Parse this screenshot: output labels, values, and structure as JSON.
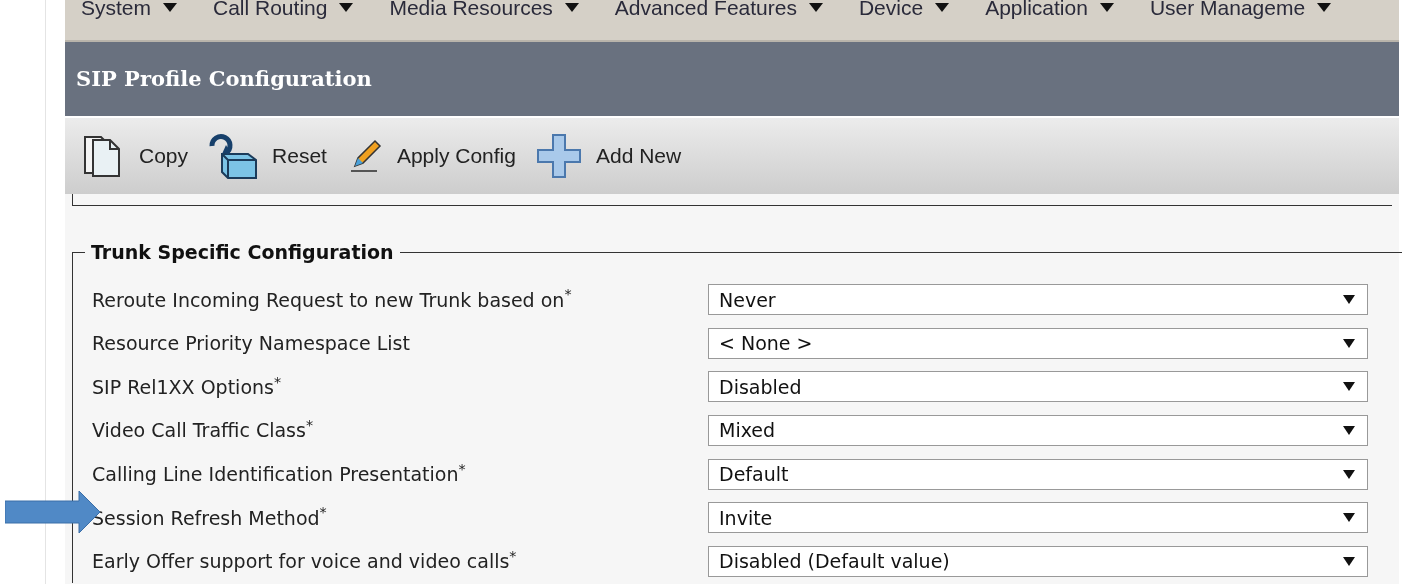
{
  "menu": [
    "System",
    "Call Routing",
    "Media Resources",
    "Advanced Features",
    "Device",
    "Application",
    "User Manageme"
  ],
  "title": "SIP Profile Configuration",
  "toolbar": [
    {
      "kind": "copy",
      "label": "Copy"
    },
    {
      "kind": "reset",
      "label": "Reset"
    },
    {
      "kind": "apply",
      "label": "Apply Config"
    },
    {
      "kind": "add",
      "label": "Add New"
    }
  ],
  "section": {
    "legend": "Trunk Specific Configuration",
    "rows": [
      {
        "label": "Reroute Incoming Request to new Trunk based on$^{*}$",
        "value": "Never",
        "pointed": false
      },
      {
        "label": "Resource Priority Namespace List",
        "value": "< None >",
        "pointed": false
      },
      {
        "label": "SIP Rel1XX Options$^{*}$",
        "value": "Disabled",
        "pointed": false
      },
      {
        "label": "Video Call Traffic Class$^{*}$",
        "value": "Mixed",
        "pointed": false
      },
      {
        "label": "Calling Line Identification Presentation$^{*}$",
        "value": "Default",
        "pointed": false
      },
      {
        "label": "Session Refresh Method$^{*}$",
        "value": "Invite",
        "pointed": true
      },
      {
        "label": "Early Offer support for voice and video calls$^{*}$",
        "value": "Disabled (Default value)",
        "pointed": false
      }
    ]
  }
}
